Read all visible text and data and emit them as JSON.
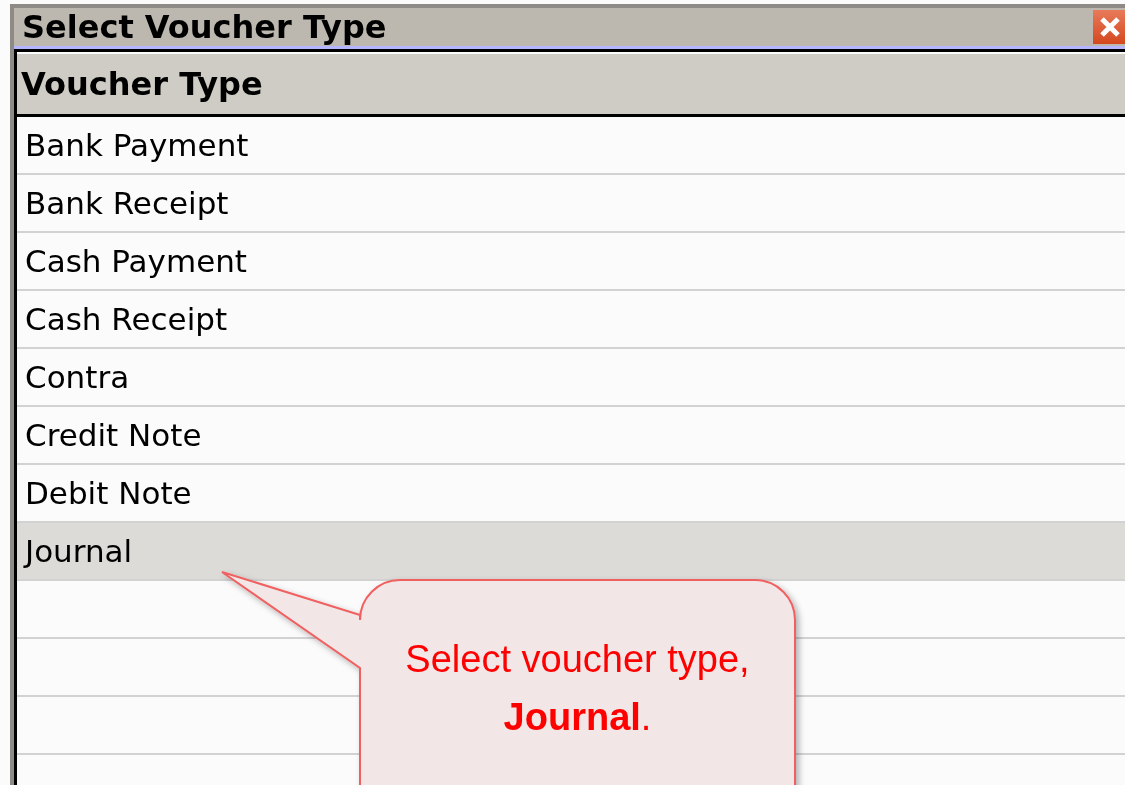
{
  "dialog": {
    "title": "Select Voucher Type"
  },
  "table": {
    "columns": [
      "Voucher Type"
    ],
    "rows": [
      {
        "label": "Bank Payment",
        "selected": false
      },
      {
        "label": "Bank Receipt",
        "selected": false
      },
      {
        "label": "Cash Payment",
        "selected": false
      },
      {
        "label": "Cash Receipt",
        "selected": false
      },
      {
        "label": "Contra",
        "selected": false
      },
      {
        "label": "Credit Note",
        "selected": false
      },
      {
        "label": "Debit Note",
        "selected": false
      },
      {
        "label": "Journal",
        "selected": true
      }
    ]
  },
  "callout": {
    "text": "Select voucher type, **Journal**."
  }
}
